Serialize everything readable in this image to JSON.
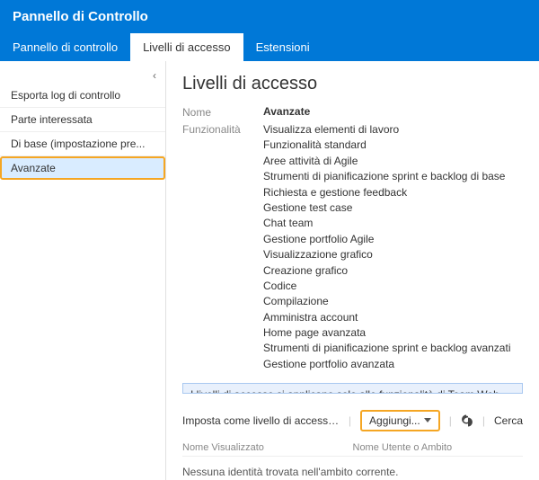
{
  "header": {
    "title": "Pannello di Controllo",
    "tabs": [
      {
        "label": "Pannello di controllo"
      },
      {
        "label": "Livelli di accesso"
      },
      {
        "label": "Estensioni"
      }
    ],
    "active_tab_index": 1
  },
  "sidebar": {
    "items": [
      {
        "label": "Esporta log di controllo"
      },
      {
        "label": "Parte interessata"
      },
      {
        "label": "Di base (impostazione pre..."
      },
      {
        "label": "Avanzate"
      }
    ],
    "selected_index": 3
  },
  "main": {
    "heading": "Livelli di accesso",
    "name_label": "Nome",
    "name_value": "Avanzate",
    "features_label": "Funzionalità",
    "features": [
      "Visualizza elementi di lavoro",
      "Funzionalità standard",
      "Aree attività di Agile",
      "Strumenti di pianificazione sprint e backlog di base",
      "Richiesta e gestione feedback",
      "Gestione test case",
      "Chat team",
      "Gestione portfolio Agile",
      "Visualizzazione grafico",
      "Creazione grafico",
      "Codice",
      "Compilazione",
      "Amministra account",
      "Home page avanzata",
      "Strumenti di pianificazione sprint e backlog avanzati",
      "Gestione portfolio avanzata"
    ],
    "info_text": "I livelli di accesso si applicano solo alle funzionalità di Team Web Access. Per alt...",
    "actions": {
      "set_default": "Imposta come livello di accesso pre...",
      "add": "Aggiungi...",
      "search": "Cerca"
    },
    "grid": {
      "col_name": "Nome Visualizzato",
      "col_user": "Nome Utente o Ambito",
      "empty": "Nessuna identità trovata nell'ambito corrente."
    }
  }
}
